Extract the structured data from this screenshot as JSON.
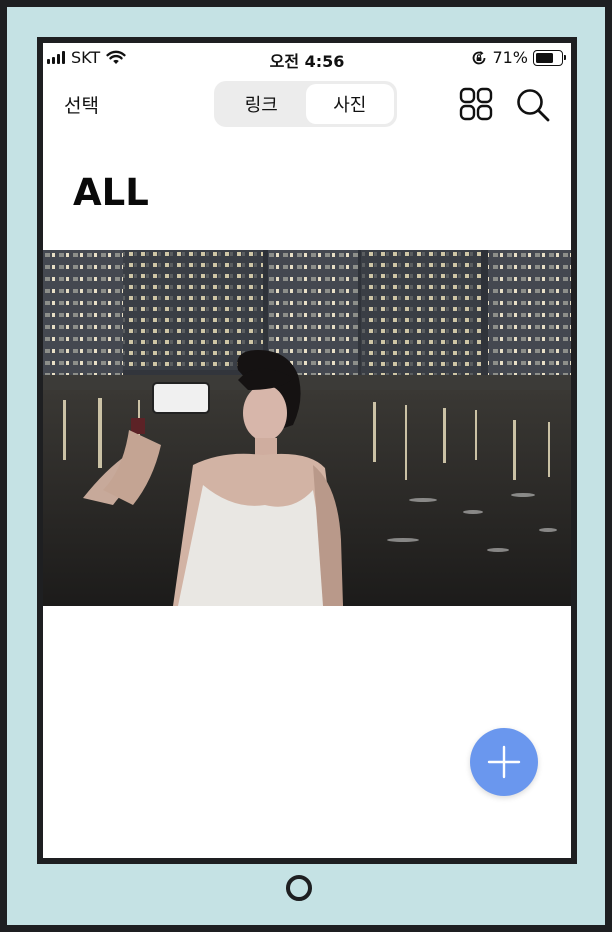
{
  "status_bar": {
    "carrier": "SKT",
    "time": "오전 4:56",
    "battery_percent": "71%",
    "battery_level": 0.71,
    "icons": [
      "signal-icon",
      "wifi-icon",
      "orientation-lock-icon",
      "battery-icon"
    ]
  },
  "nav": {
    "select_label": "선택",
    "tabs": [
      {
        "label": "링크",
        "active": false
      },
      {
        "label": "사진",
        "active": true
      }
    ],
    "icons": [
      "grid-view-icon",
      "search-icon"
    ]
  },
  "page": {
    "title": "ALL"
  },
  "photos": [
    {
      "subject": "photo-woman-night-river"
    }
  ],
  "fab": {
    "icon": "plus-icon"
  },
  "colors": {
    "frame": "#1e1f21",
    "device_bg": "#c5e2e4",
    "segment_bg": "#ececec",
    "fab": "#6a97ee"
  }
}
